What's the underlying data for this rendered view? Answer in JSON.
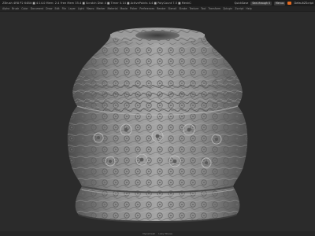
{
  "window": {
    "title": "ZBrush 4R8 P2 64Bit  ■ 4:14.0 Mem: 2.4 Free Mem 35.4 ■ Scratch Disk 4 ■ Timer 0.14 ■ ActivePoints 4.4 ■ PolyCount 7.5 ■ MeshCount 1",
    "quicksave": "QuickSave",
    "see_through": "See-through 0",
    "menus_button": "Menus",
    "script_label": "DefaultZScript"
  },
  "menu": {
    "items": [
      "Alpha",
      "Brush",
      "Color",
      "Document",
      "Draw",
      "Edit",
      "File",
      "Layer",
      "Light",
      "Macro",
      "Marker",
      "Material",
      "Movie",
      "Picker",
      "Preferences",
      "Render",
      "Stencil",
      "Stroke",
      "Texture",
      "Tool",
      "Transform",
      "Zplugin",
      "Zscript",
      "Help"
    ]
  },
  "status": {
    "left": "Dynamesh",
    "right": "Lazy Mouse"
  },
  "colors": {
    "accent": "#e06a2a",
    "viewport_bg": "#2b2b2b",
    "model_base": "#8d8d8d"
  },
  "icons": {
    "model": "sculpted-vase-model",
    "orange": "orange-swatch-icon"
  }
}
